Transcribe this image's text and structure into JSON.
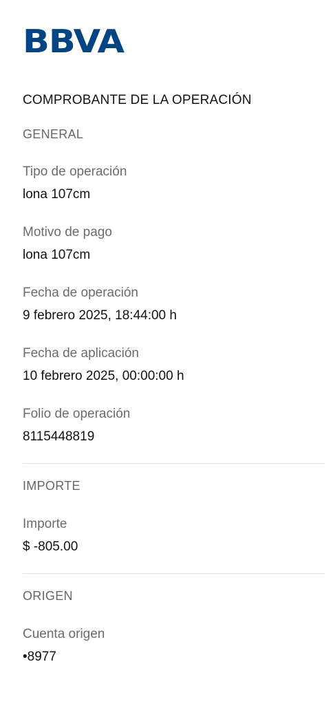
{
  "brand": {
    "logo_text": "BBVA",
    "color": "#004481"
  },
  "receipt": {
    "title": "COMPROBANTE DE LA OPERACIÓN"
  },
  "sections": {
    "general": {
      "title": "GENERAL",
      "fields": [
        {
          "label": "Tipo de operación",
          "value": "lona 107cm"
        },
        {
          "label": "Motivo de pago",
          "value": "lona 107cm"
        },
        {
          "label": "Fecha de operación",
          "value": "9 febrero 2025, 18:44:00 h"
        },
        {
          "label": "Fecha de aplicación",
          "value": "10 febrero 2025, 00:00:00 h"
        },
        {
          "label": "Folio de operación",
          "value": "8115448819"
        }
      ]
    },
    "importe": {
      "title": "IMPORTE",
      "fields": [
        {
          "label": "Importe",
          "value": "$ -805.00"
        }
      ]
    },
    "origen": {
      "title": "ORIGEN",
      "fields": [
        {
          "label": "Cuenta origen",
          "value": "•8977"
        }
      ]
    }
  }
}
